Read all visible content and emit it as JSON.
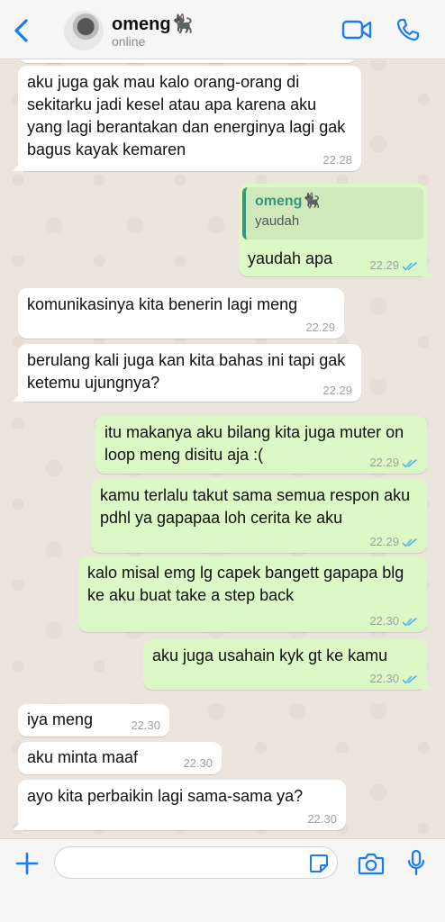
{
  "header": {
    "contact_name": "omeng🐈‍⬛",
    "status": "online"
  },
  "messages": [
    {
      "direction": "in",
      "text": "aku juga gak mau kalo orang-orang di sekitarku jadi kesel atau apa karena aku yang lagi berantakan dan energinya lagi gak bagus kayak kemaren",
      "time": "22.28"
    },
    {
      "direction": "out",
      "quote_name": "omeng🐈‍⬛",
      "quote_text": "yaudah",
      "text": "yaudah apa",
      "time": "22.29",
      "status": "read"
    },
    {
      "direction": "in",
      "text": "komunikasinya kita benerin lagi meng",
      "time": "22.29"
    },
    {
      "direction": "in",
      "text": "berulang kali juga kan kita bahas ini tapi gak ketemu ujungnya?",
      "time": "22.29"
    },
    {
      "direction": "out",
      "text": "itu makanya aku bilang kita juga muter on loop meng disitu aja :(",
      "time": "22.29",
      "status": "read"
    },
    {
      "direction": "out",
      "text": "kamu terlalu takut sama semua respon aku pdhl ya gapapaa loh cerita ke aku",
      "time": "22.29",
      "status": "read"
    },
    {
      "direction": "out",
      "text": "kalo misal emg lg capek bangett gapapa blg ke aku buat take a step back",
      "time": "22.30",
      "status": "read"
    },
    {
      "direction": "out",
      "text": "aku juga usahain kyk gt ke kamu",
      "time": "22.30",
      "status": "read"
    },
    {
      "direction": "in",
      "text": "iya meng",
      "time": "22.30"
    },
    {
      "direction": "in",
      "text": "aku minta maaf",
      "time": "22.30"
    },
    {
      "direction": "in",
      "text": "ayo kita perbaikin lagi sama-sama ya?",
      "time": "22.30"
    }
  ],
  "composer": {
    "value": "",
    "placeholder": ""
  },
  "icons": {
    "back": "chevron-left-icon",
    "video": "video-camera-icon",
    "call": "phone-icon",
    "attach": "plus-icon",
    "sticker": "sticker-icon",
    "camera": "camera-icon",
    "mic": "microphone-icon",
    "read_receipt": "double-check-icon"
  },
  "colors": {
    "accent": "#1a7cf5",
    "outgoing_bubble": "#dcf8c6",
    "incoming_bubble": "#ffffff",
    "quote_accent": "#35987a",
    "read_check": "#4fb6ec",
    "chat_background": "#ece5dd"
  }
}
